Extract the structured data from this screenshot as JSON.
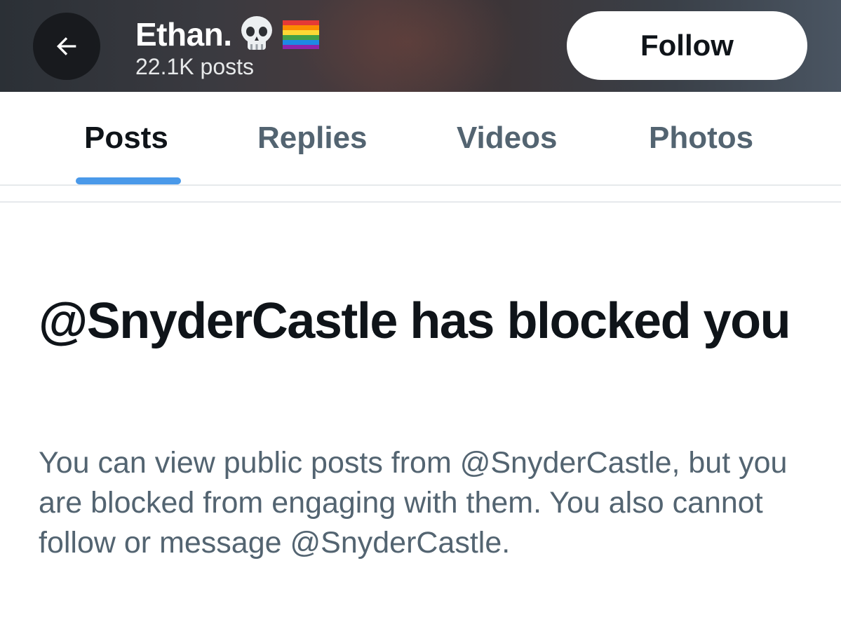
{
  "header": {
    "name": "Ethan.",
    "name_emojis": [
      "skull-emoji",
      "rainbow-flag-emoji"
    ],
    "posts_count": "22.1K posts",
    "follow_label": "Follow",
    "back_icon": "arrow-left-icon"
  },
  "tabs": [
    {
      "label": "Posts",
      "active": true
    },
    {
      "label": "Replies",
      "active": false
    },
    {
      "label": "Videos",
      "active": false
    },
    {
      "label": "Photos",
      "active": false
    }
  ],
  "blocked": {
    "title": "@SnyderCastle has blocked you",
    "description": "You can view public posts from @SnyderCastle, but you are blocked from engaging with them. You also cannot follow or message @SnyderCastle."
  },
  "colors": {
    "accent": "#4a99e9",
    "primary_text": "#0f1419",
    "secondary_text": "#536471"
  }
}
